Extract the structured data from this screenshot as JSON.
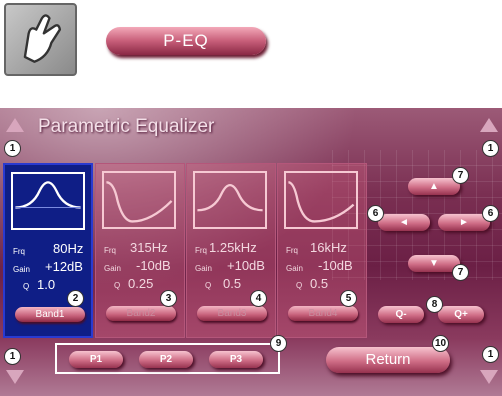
{
  "header": {
    "mode_label": "P-EQ"
  },
  "panel": {
    "title": "Parametric Equalizer"
  },
  "field_labels": {
    "frq": "Frq",
    "gain": "Gain",
    "q": "Q"
  },
  "bands": [
    {
      "label": "Band1",
      "frq": "80Hz",
      "gain": "+12dB",
      "q": "1.0",
      "selected": true,
      "curve": "peak"
    },
    {
      "label": "Band2",
      "frq": "315Hz",
      "gain": "-10dB",
      "q": "0.25",
      "selected": false,
      "curve": "dip"
    },
    {
      "label": "Band3",
      "frq": "1.25kHz",
      "gain": "+10dB",
      "q": "0.5",
      "selected": false,
      "curve": "peak"
    },
    {
      "label": "Band4",
      "frq": "16kHz",
      "gain": "-10dB",
      "q": "0.5",
      "selected": false,
      "curve": "dip"
    }
  ],
  "controls": {
    "q_minus": "Q-",
    "q_plus": "Q+",
    "presets": [
      "P1",
      "P2",
      "P3"
    ],
    "return": "Return"
  },
  "callouts": [
    "1",
    "1",
    "1",
    "1",
    "2",
    "3",
    "4",
    "5",
    "6",
    "6",
    "7",
    "7",
    "8",
    "9",
    "10"
  ],
  "colors": {
    "selected_band": "#0f1e86",
    "button": "#cf6d86",
    "panel": "#6b1f45"
  }
}
